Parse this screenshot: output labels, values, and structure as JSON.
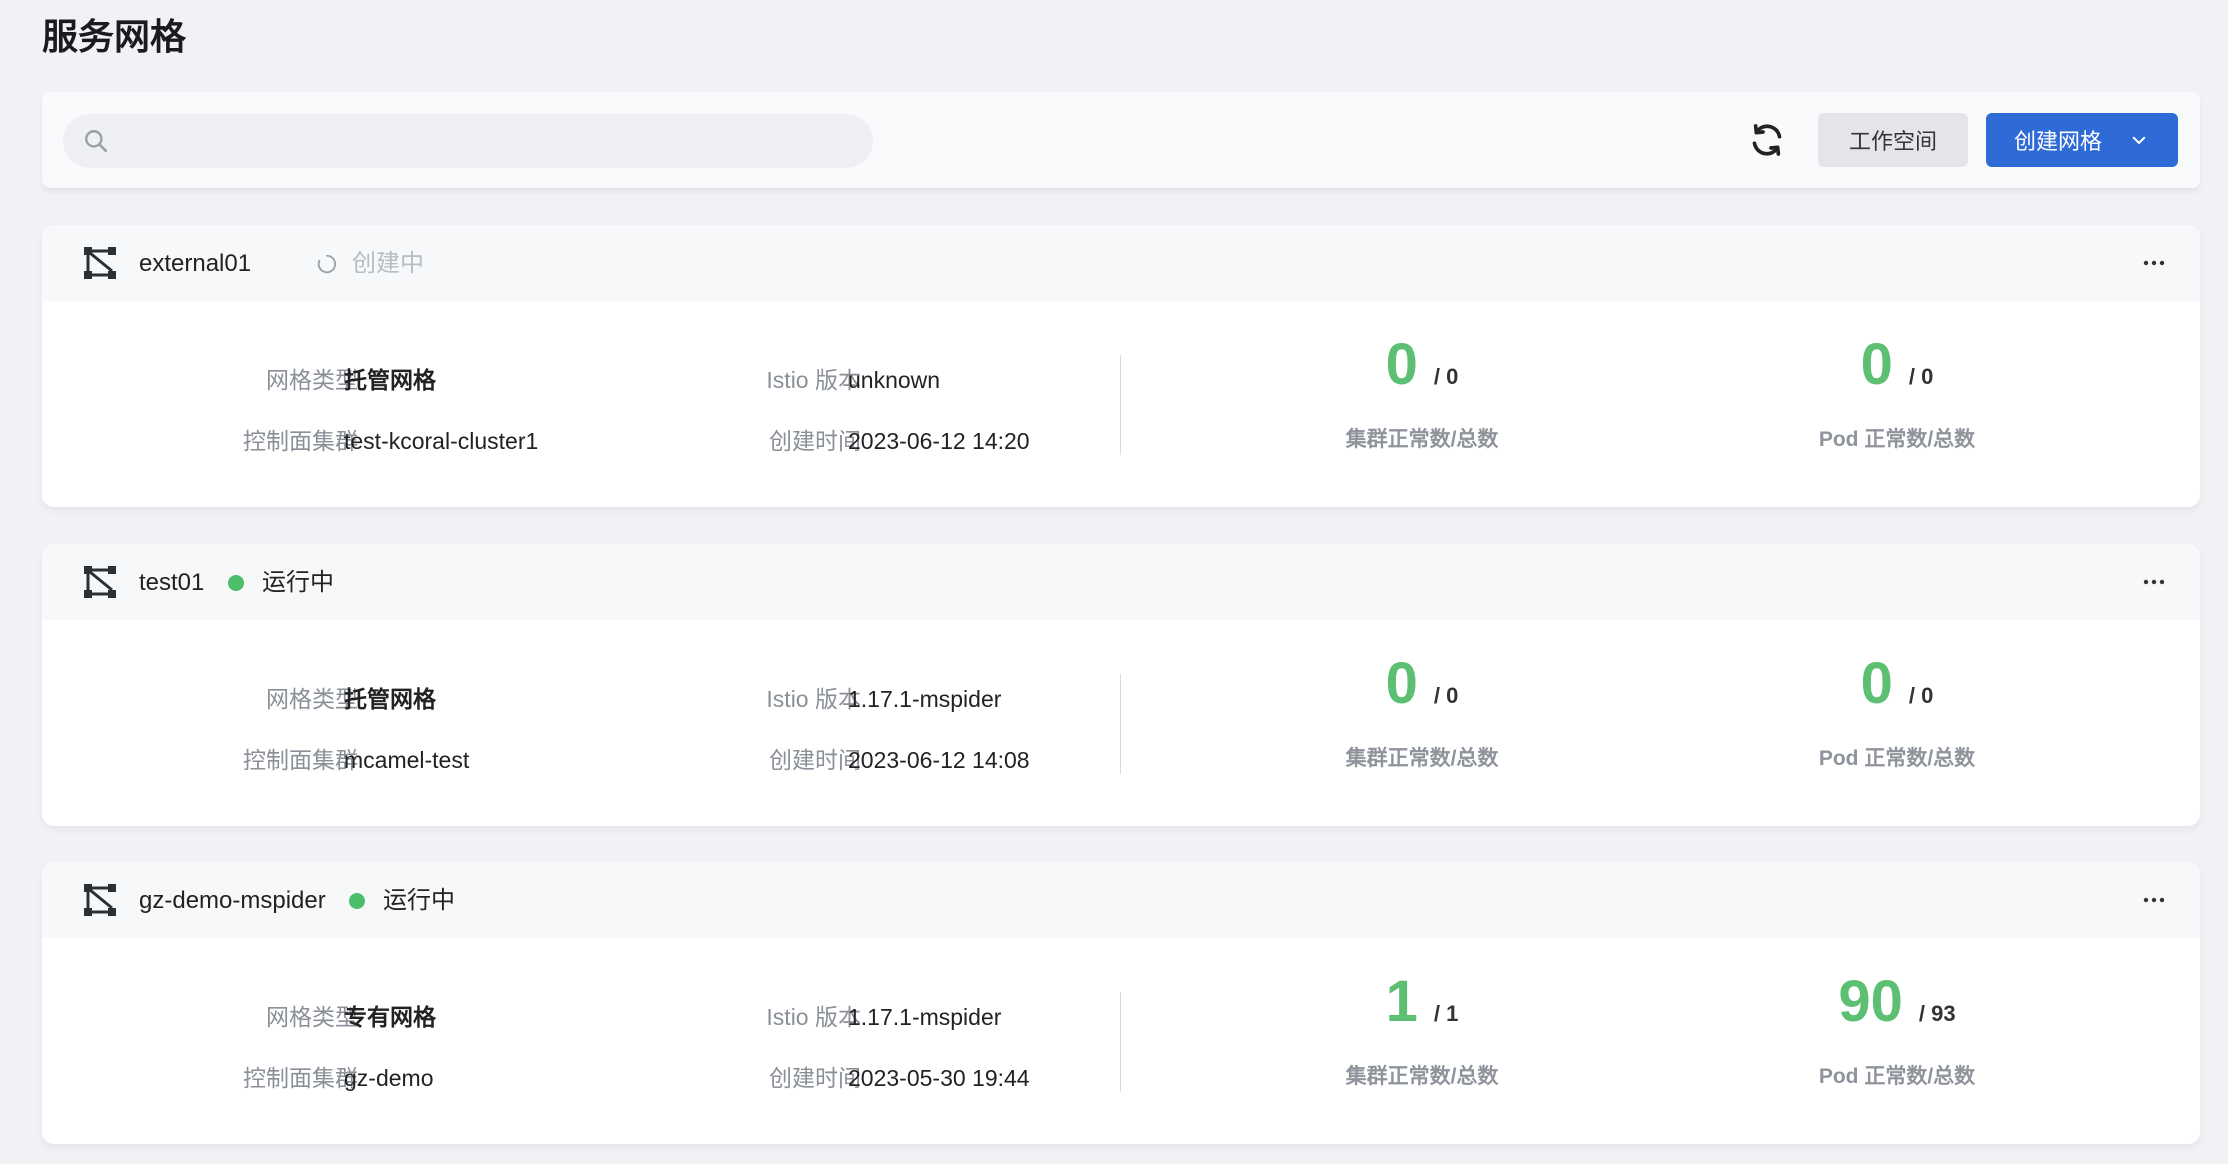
{
  "page": {
    "title": "服务网格"
  },
  "toolbar": {
    "search_placeholder": "",
    "refresh_icon": "refresh-icon",
    "workspace_label": "工作空间",
    "create_label": "创建网格"
  },
  "labels": {
    "mesh_type": "网格类型",
    "control_cluster": "控制面集群",
    "istio_version": "Istio 版本",
    "created_time": "创建时间",
    "cluster_caption": "集群正常数/总数",
    "pod_caption": "Pod 正常数/总数"
  },
  "colors": {
    "primary": "#2f6bd6",
    "success": "#5cbf72",
    "status_dot": "#4cbe6a",
    "creating_text": "#b8bcc4"
  },
  "meshes": [
    {
      "name": "external01",
      "status": "创建中",
      "status_kind": "creating",
      "mesh_type": "托管网格",
      "control_cluster": "test-kcoral-cluster1",
      "istio_version": "unknown",
      "created_time": "2023-06-12 14:20",
      "cluster_ok": "0",
      "cluster_total": "/ 0",
      "pod_ok": "0",
      "pod_total": "/ 0"
    },
    {
      "name": "test01",
      "status": "运行中",
      "status_kind": "running",
      "mesh_type": "托管网格",
      "control_cluster": "mcamel-test",
      "istio_version": "1.17.1-mspider",
      "created_time": "2023-06-12 14:08",
      "cluster_ok": "0",
      "cluster_total": "/ 0",
      "pod_ok": "0",
      "pod_total": "/ 0"
    },
    {
      "name": "gz-demo-mspider",
      "status": "运行中",
      "status_kind": "running",
      "mesh_type": "专有网格",
      "control_cluster": "gz-demo",
      "istio_version": "1.17.1-mspider",
      "created_time": "2023-05-30 19:44",
      "cluster_ok": "1",
      "cluster_total": "/ 1",
      "pod_ok": "90",
      "pod_total": "/ 93"
    }
  ]
}
